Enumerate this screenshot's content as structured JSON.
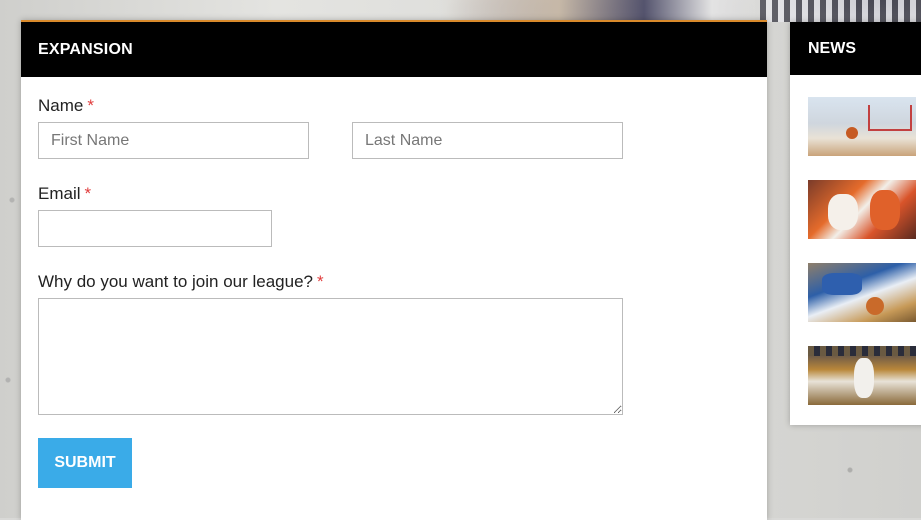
{
  "form_panel": {
    "title": "EXPANSION",
    "name_label": "Name",
    "required_marker": "*",
    "first_name_placeholder": "First Name",
    "last_name_placeholder": "Last Name",
    "first_name_value": "",
    "last_name_value": "",
    "email_label": "Email",
    "email_value": "",
    "question_label": "Why do you want to join our league?",
    "question_value": "",
    "submit_label": "SUBMIT"
  },
  "news_panel": {
    "title": "NEWS",
    "items": [
      {
        "thumb": "basketball-hoop-photo"
      },
      {
        "thumb": "players-contest-photo"
      },
      {
        "thumb": "player-dive-photo"
      },
      {
        "thumb": "dunk-arena-photo"
      }
    ]
  },
  "colors": {
    "header_bg": "#000000",
    "accent_orange": "#d98a2b",
    "submit_blue": "#3aabe8",
    "required_red": "#e03b3b"
  }
}
